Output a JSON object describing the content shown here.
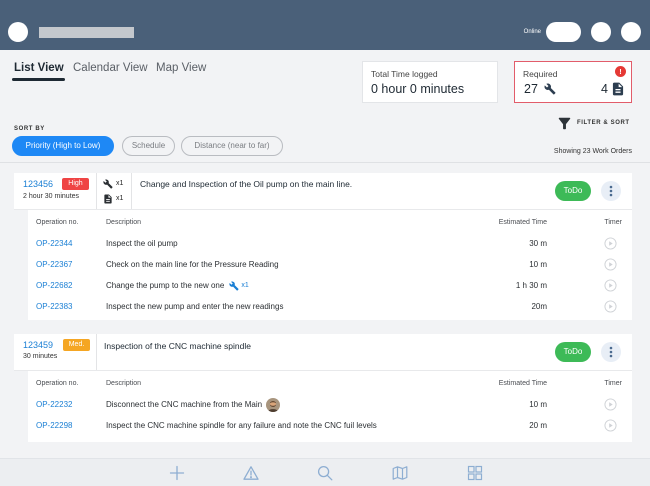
{
  "header": {
    "status_label": "Online"
  },
  "tabs": [
    {
      "label": "List View",
      "active": true
    },
    {
      "label": "Calendar View",
      "active": false
    },
    {
      "label": "Map View",
      "active": false
    }
  ],
  "summary": {
    "time_logged": {
      "label": "Total Time logged",
      "value": "0 hour 0 minutes"
    },
    "required": {
      "label": "Required",
      "alert_symbol": "!",
      "tools_count": "27",
      "tools_icon": "wrench-icon",
      "documents_count": "4",
      "documents_icon": "document-icon"
    }
  },
  "sort": {
    "label": "SORT BY",
    "options": [
      {
        "label": "Priority (High to Low)",
        "selected": true
      },
      {
        "label": "Schedule",
        "selected": false
      },
      {
        "label": "Distance (near to far)",
        "selected": false
      }
    ],
    "filter_icon": "filter-icon",
    "filter_label": "FILTER & SORT",
    "result_count_text": "Showing 23 Work Orders"
  },
  "operations_columns": {
    "code": "Operation no.",
    "description": "Description",
    "estimated_time": "Estimated Time",
    "timer": "Timer"
  },
  "work_orders": [
    {
      "id": "123456",
      "priority": "High",
      "priority_color": "#ef4444",
      "duration": "2 hour 30 minutes",
      "tools_count": "x1",
      "documents_count": "x1",
      "title": "Change and Inspection of the Oil pump on the main line.",
      "status": "ToDo",
      "operations": [
        {
          "code": "OP-22344",
          "description": "Inspect the oil pump",
          "estimated_time": "30 m"
        },
        {
          "code": "OP-22367",
          "description": "Check on the main line for the Pressure Reading",
          "estimated_time": "10 m"
        },
        {
          "code": "OP-22682",
          "description": "Change the pump to the new one",
          "tool_count": "x1",
          "estimated_time": "1 h 30 m"
        },
        {
          "code": "OP-22383",
          "description": "Inspect the new pump and enter the new readings",
          "estimated_time": "20m"
        }
      ]
    },
    {
      "id": "123459",
      "priority": "Med.",
      "priority_color": "#f5a623",
      "duration": "30 minutes",
      "title": "Inspection of the CNC machine spindle",
      "status": "ToDo",
      "operations": [
        {
          "code": "OP-22232",
          "description": "Disconnect the CNC machine from the Main",
          "assignee_icon": "avatar",
          "estimated_time": "10 m"
        },
        {
          "code": "OP-22298",
          "description": "Inspect the CNC machine spindle for any failure and note the CNC fuil levels",
          "estimated_time": "20 m"
        }
      ]
    }
  ],
  "bottom_nav": [
    {
      "icon": "plus-icon"
    },
    {
      "icon": "warning-icon"
    },
    {
      "icon": "search-icon"
    },
    {
      "icon": "map-icon"
    },
    {
      "icon": "grid-icon"
    }
  ],
  "colors": {
    "header_background": "#4a6079",
    "accent_blue": "#1e88f5",
    "link_blue": "#1a7fd4",
    "todo_green": "#3dba57",
    "required_border": "#e25c6a",
    "nav_icon": "#8eaed2"
  }
}
